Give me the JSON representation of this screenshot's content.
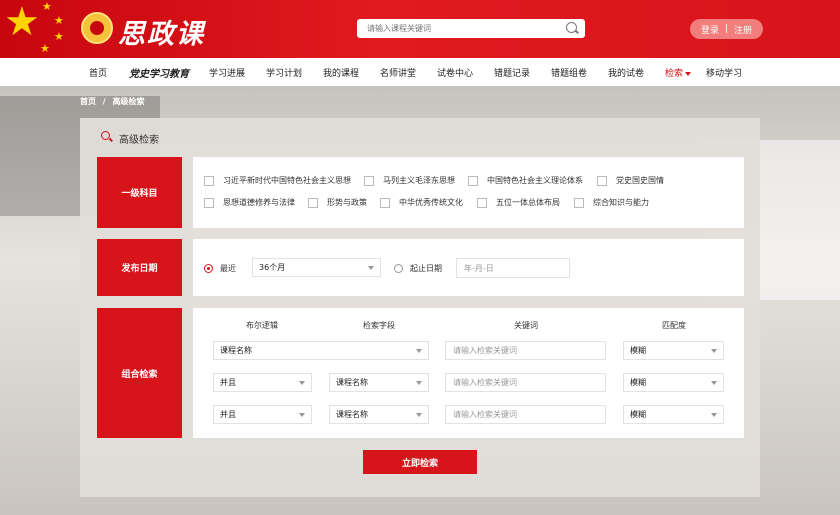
{
  "header": {
    "logo_text": "思政课",
    "search_placeholder": "请输入课程关键词",
    "login_label": "登录",
    "divider": "|",
    "register_label": "注册"
  },
  "nav": {
    "items": [
      "首页",
      "党史学习教育",
      "学习进展",
      "学习计划",
      "我的课程",
      "名师讲堂",
      "试卷中心",
      "错题记录",
      "错题组卷",
      "我的试卷",
      "检索",
      "移动学习"
    ],
    "active": "检索"
  },
  "breadcrumb": {
    "home": "首页",
    "sep": "/",
    "current": "高级检索"
  },
  "panel": {
    "title": "高级检索"
  },
  "sections": {
    "subject": {
      "label": "一级科目",
      "options": [
        "习近平新时代中国特色社会主义思想",
        "马列主义毛泽东思想",
        "中国特色社会主义理论体系",
        "党史国史国情",
        "思想道德修养与法律",
        "形势与政策",
        "中华优秀传统文化",
        "五位一体总体布局",
        "综合知识与能力"
      ]
    },
    "date": {
      "label": "发布日期",
      "recent_label": "最近",
      "recent_value": "36个月",
      "range_label": "起止日期",
      "date_placeholder": "年-月-日"
    },
    "combo": {
      "label": "组合检索",
      "headers": {
        "logic": "布尔逻辑",
        "field": "检索字段",
        "keyword": "关键词",
        "match": "匹配度"
      },
      "rows": [
        {
          "field": "课程名称",
          "keyword_placeholder": "请输入检索关键词",
          "match": "模糊"
        },
        {
          "logic": "并且",
          "field": "课程名称",
          "keyword_placeholder": "请输入检索关键词",
          "match": "模糊"
        },
        {
          "logic": "并且",
          "field": "课程名称",
          "keyword_placeholder": "请输入检索关键词",
          "match": "模糊"
        }
      ]
    }
  },
  "submit_label": "立即检索",
  "colors": {
    "accent": "#d7141a",
    "header_bg": "#d7141a",
    "star": "#ffd400"
  }
}
